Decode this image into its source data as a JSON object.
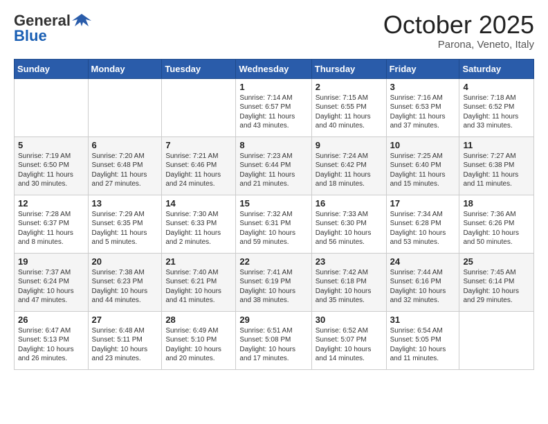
{
  "header": {
    "logo_general": "General",
    "logo_blue": "Blue",
    "month_title": "October 2025",
    "subtitle": "Parona, Veneto, Italy"
  },
  "weekdays": [
    "Sunday",
    "Monday",
    "Tuesday",
    "Wednesday",
    "Thursday",
    "Friday",
    "Saturday"
  ],
  "weeks": [
    [
      {
        "day": "",
        "info": ""
      },
      {
        "day": "",
        "info": ""
      },
      {
        "day": "",
        "info": ""
      },
      {
        "day": "1",
        "info": "Sunrise: 7:14 AM\nSunset: 6:57 PM\nDaylight: 11 hours\nand 43 minutes."
      },
      {
        "day": "2",
        "info": "Sunrise: 7:15 AM\nSunset: 6:55 PM\nDaylight: 11 hours\nand 40 minutes."
      },
      {
        "day": "3",
        "info": "Sunrise: 7:16 AM\nSunset: 6:53 PM\nDaylight: 11 hours\nand 37 minutes."
      },
      {
        "day": "4",
        "info": "Sunrise: 7:18 AM\nSunset: 6:52 PM\nDaylight: 11 hours\nand 33 minutes."
      }
    ],
    [
      {
        "day": "5",
        "info": "Sunrise: 7:19 AM\nSunset: 6:50 PM\nDaylight: 11 hours\nand 30 minutes."
      },
      {
        "day": "6",
        "info": "Sunrise: 7:20 AM\nSunset: 6:48 PM\nDaylight: 11 hours\nand 27 minutes."
      },
      {
        "day": "7",
        "info": "Sunrise: 7:21 AM\nSunset: 6:46 PM\nDaylight: 11 hours\nand 24 minutes."
      },
      {
        "day": "8",
        "info": "Sunrise: 7:23 AM\nSunset: 6:44 PM\nDaylight: 11 hours\nand 21 minutes."
      },
      {
        "day": "9",
        "info": "Sunrise: 7:24 AM\nSunset: 6:42 PM\nDaylight: 11 hours\nand 18 minutes."
      },
      {
        "day": "10",
        "info": "Sunrise: 7:25 AM\nSunset: 6:40 PM\nDaylight: 11 hours\nand 15 minutes."
      },
      {
        "day": "11",
        "info": "Sunrise: 7:27 AM\nSunset: 6:38 PM\nDaylight: 11 hours\nand 11 minutes."
      }
    ],
    [
      {
        "day": "12",
        "info": "Sunrise: 7:28 AM\nSunset: 6:37 PM\nDaylight: 11 hours\nand 8 minutes."
      },
      {
        "day": "13",
        "info": "Sunrise: 7:29 AM\nSunset: 6:35 PM\nDaylight: 11 hours\nand 5 minutes."
      },
      {
        "day": "14",
        "info": "Sunrise: 7:30 AM\nSunset: 6:33 PM\nDaylight: 11 hours\nand 2 minutes."
      },
      {
        "day": "15",
        "info": "Sunrise: 7:32 AM\nSunset: 6:31 PM\nDaylight: 10 hours\nand 59 minutes."
      },
      {
        "day": "16",
        "info": "Sunrise: 7:33 AM\nSunset: 6:30 PM\nDaylight: 10 hours\nand 56 minutes."
      },
      {
        "day": "17",
        "info": "Sunrise: 7:34 AM\nSunset: 6:28 PM\nDaylight: 10 hours\nand 53 minutes."
      },
      {
        "day": "18",
        "info": "Sunrise: 7:36 AM\nSunset: 6:26 PM\nDaylight: 10 hours\nand 50 minutes."
      }
    ],
    [
      {
        "day": "19",
        "info": "Sunrise: 7:37 AM\nSunset: 6:24 PM\nDaylight: 10 hours\nand 47 minutes."
      },
      {
        "day": "20",
        "info": "Sunrise: 7:38 AM\nSunset: 6:23 PM\nDaylight: 10 hours\nand 44 minutes."
      },
      {
        "day": "21",
        "info": "Sunrise: 7:40 AM\nSunset: 6:21 PM\nDaylight: 10 hours\nand 41 minutes."
      },
      {
        "day": "22",
        "info": "Sunrise: 7:41 AM\nSunset: 6:19 PM\nDaylight: 10 hours\nand 38 minutes."
      },
      {
        "day": "23",
        "info": "Sunrise: 7:42 AM\nSunset: 6:18 PM\nDaylight: 10 hours\nand 35 minutes."
      },
      {
        "day": "24",
        "info": "Sunrise: 7:44 AM\nSunset: 6:16 PM\nDaylight: 10 hours\nand 32 minutes."
      },
      {
        "day": "25",
        "info": "Sunrise: 7:45 AM\nSunset: 6:14 PM\nDaylight: 10 hours\nand 29 minutes."
      }
    ],
    [
      {
        "day": "26",
        "info": "Sunrise: 6:47 AM\nSunset: 5:13 PM\nDaylight: 10 hours\nand 26 minutes."
      },
      {
        "day": "27",
        "info": "Sunrise: 6:48 AM\nSunset: 5:11 PM\nDaylight: 10 hours\nand 23 minutes."
      },
      {
        "day": "28",
        "info": "Sunrise: 6:49 AM\nSunset: 5:10 PM\nDaylight: 10 hours\nand 20 minutes."
      },
      {
        "day": "29",
        "info": "Sunrise: 6:51 AM\nSunset: 5:08 PM\nDaylight: 10 hours\nand 17 minutes."
      },
      {
        "day": "30",
        "info": "Sunrise: 6:52 AM\nSunset: 5:07 PM\nDaylight: 10 hours\nand 14 minutes."
      },
      {
        "day": "31",
        "info": "Sunrise: 6:54 AM\nSunset: 5:05 PM\nDaylight: 10 hours\nand 11 minutes."
      },
      {
        "day": "",
        "info": ""
      }
    ]
  ]
}
